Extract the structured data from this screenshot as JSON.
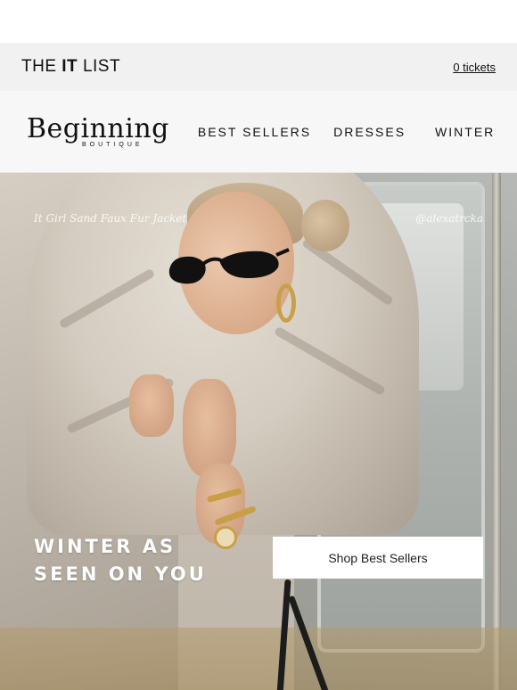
{
  "header": {
    "title_prefix": "THE",
    "title_bold": "IT",
    "title_suffix": "LIST",
    "tickets_link": "0 tickets"
  },
  "brand": {
    "logo_word": "Beginning",
    "logo_sub": "BOUTIQUE"
  },
  "nav": {
    "items": [
      {
        "label": "BEST SELLERS"
      },
      {
        "label": "DRESSES"
      },
      {
        "label": "WINTER"
      }
    ]
  },
  "hero": {
    "caption_product": "It Girl Sand Faux Fur Jacket",
    "caption_handle": "@alexatrcka",
    "headline_line1": "WINTER AS",
    "headline_line2": "SEEN ON YOU",
    "cta_label": "Shop Best Sellers"
  },
  "colors": {
    "it_bar_bg": "#f1f1f1",
    "nav_bg": "#f7f7f7",
    "cta_bg": "#ffffff",
    "headline_text": "#ffffff"
  },
  "icons": {
    "hero_image": "photo-woman-faux-fur-jacket-subway"
  }
}
